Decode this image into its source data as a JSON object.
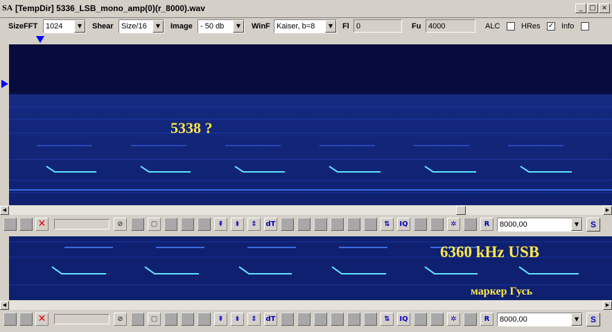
{
  "window": {
    "icon_text": "SA",
    "title": "[TempDir] 5336_LSB_mono_amp(0)(r_8000).wav",
    "minimize": "_",
    "maximize": "□",
    "close": "×"
  },
  "toolbar": {
    "sizefft_label": "SizeFFT",
    "sizefft_value": "1024",
    "shear_label": "Shear",
    "shear_value": "Size/16",
    "image_label": "Image",
    "image_value": "- 50 db",
    "winf_label": "WinF",
    "winf_value": "Kaiser, b=8",
    "fl_label": "Fl",
    "fl_value": "0",
    "fu_label": "Fu",
    "fu_value": "4000",
    "alc_label": "ALC",
    "alc_checked": false,
    "hres_label": "HRes",
    "hres_checked": true,
    "info_label": "Info",
    "info_checked": false
  },
  "spectrogram_top": {
    "annotation": "5338 ?"
  },
  "spectrogram_bottom": {
    "annotation_freq": "6360 kHz USB",
    "annotation_marker": "маркер Гусь"
  },
  "button_bar_top": {
    "freq_value": "8000,00",
    "s_label": "S",
    "r_label": "R",
    "dt_label": "dT",
    "iq_label": "IQ"
  },
  "button_bar_bottom": {
    "freq_value": "8000,00",
    "s_label": "S",
    "r_label": "R",
    "dt_label": "dT",
    "iq_label": "IQ"
  },
  "colors": {
    "spectrogram_bg": "#070c3c",
    "annotation": "#ffe84a",
    "signal": "#5fe6ff"
  }
}
